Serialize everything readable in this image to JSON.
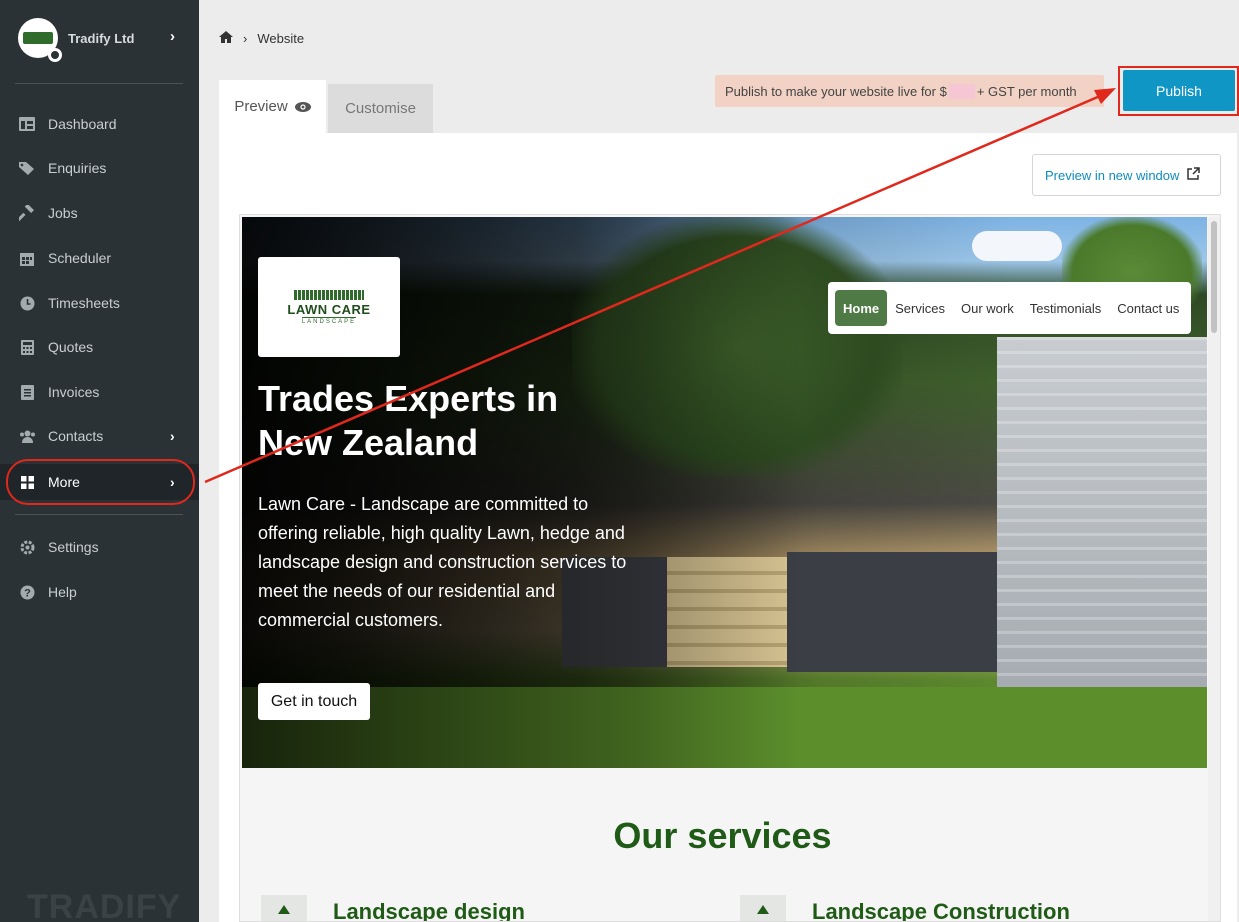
{
  "sidebar": {
    "company": "Tradify Ltd",
    "items": [
      {
        "label": "Dashboard",
        "icon": "dashboard-icon"
      },
      {
        "label": "Enquiries",
        "icon": "tag-icon"
      },
      {
        "label": "Jobs",
        "icon": "hammer-icon"
      },
      {
        "label": "Scheduler",
        "icon": "calendar-icon"
      },
      {
        "label": "Timesheets",
        "icon": "clock-icon"
      },
      {
        "label": "Quotes",
        "icon": "calculator-icon"
      },
      {
        "label": "Invoices",
        "icon": "document-icon"
      },
      {
        "label": "Contacts",
        "icon": "users-icon"
      },
      {
        "label": "More",
        "icon": "grid-icon"
      },
      {
        "label": "Settings",
        "icon": "gear-icon"
      },
      {
        "label": "Help",
        "icon": "question-icon"
      }
    ],
    "watermark": "TRADIFY"
  },
  "breadcrumb": {
    "current": "Website"
  },
  "tabs": {
    "preview": "Preview",
    "customise": "Customise"
  },
  "notice": {
    "before": "Publish to make your website live for $",
    "after": " + GST per month"
  },
  "publish_label": "Publish",
  "preview_new_window": "Preview in new window",
  "site": {
    "logo_name": "LAWN CARE",
    "logo_sub": "LANDSCAPE",
    "nav": [
      "Home",
      "Services",
      "Our work",
      "Testimonials",
      "Contact us"
    ],
    "hero_title": "Trades Experts in New Zealand",
    "hero_text": "Lawn Care - Landscape are committed to offering reliable, high quality Lawn, hedge and landscape design and construction services to meet the needs of our residential and commercial customers.",
    "cta": "Get in touch",
    "services_title": "Our services",
    "services": [
      "Landscape design",
      "Landscape Construction"
    ]
  },
  "colors": {
    "accent": "#0f96c4",
    "annotation": "#e0281c",
    "brand_green": "#1f5b16"
  }
}
